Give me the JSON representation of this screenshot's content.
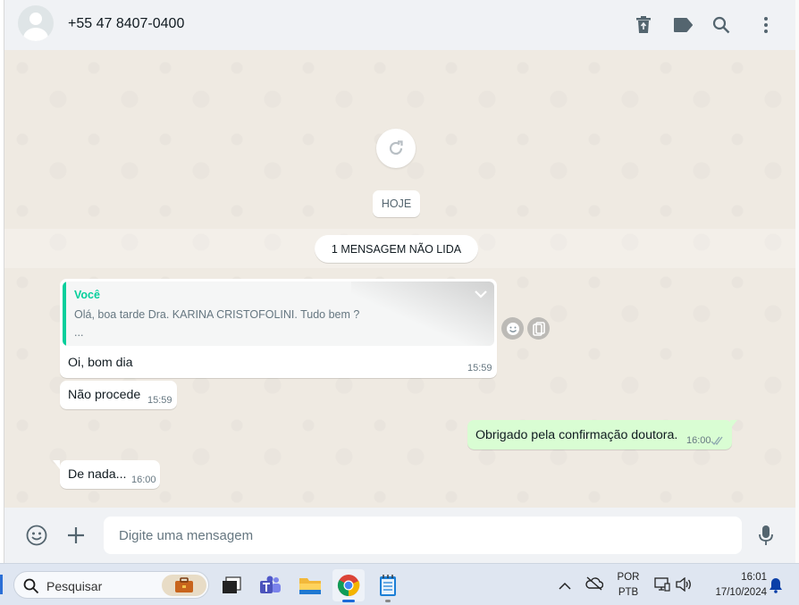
{
  "header": {
    "contact_name": "+55 47 8407-0400"
  },
  "chat": {
    "date_chip": "HOJE",
    "unread_label": "1 MENSAGEM NÃO LIDA",
    "messages": [
      {
        "direction": "in",
        "quote_author": "Você",
        "quote_text": "Olá, boa tarde Dra.  KARINA CRISTOFOLINI. Tudo bem ?",
        "quote_more": "...",
        "text": "Oi, bom dia",
        "time": "15:59"
      },
      {
        "direction": "in",
        "text": "Não procede",
        "time": "15:59"
      },
      {
        "direction": "out",
        "text": "Obrigado pela confirmação doutora.",
        "time": "16:00",
        "status": "read"
      },
      {
        "direction": "in",
        "text": "De nada...",
        "time": "16:00"
      }
    ]
  },
  "composer": {
    "placeholder": "Digite uma mensagem"
  },
  "taskbar": {
    "search_label": "Pesquisar",
    "language_top": "POR",
    "language_bottom": "PTB",
    "clock_time": "16:01",
    "clock_date": "17/10/2024"
  },
  "colors": {
    "accent_green": "#06cf9c",
    "outgoing_bubble": "#d9fdd3",
    "chat_background": "#efeae2",
    "header_background": "#f0f2f5"
  }
}
